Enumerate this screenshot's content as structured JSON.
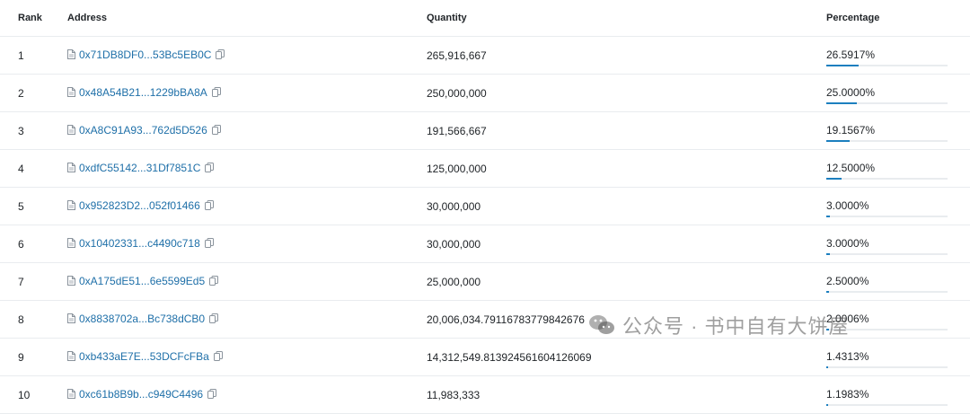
{
  "headers": {
    "rank": "Rank",
    "address": "Address",
    "quantity": "Quantity",
    "percentage": "Percentage"
  },
  "rows": [
    {
      "rank": "1",
      "address": "0x71DB8DF0...53Bc5EB0C",
      "quantity": "265,916,667",
      "percentage": "26.5917%",
      "fraction": 0.265917
    },
    {
      "rank": "2",
      "address": "0x48A54B21...1229bBA8A",
      "quantity": "250,000,000",
      "percentage": "25.0000%",
      "fraction": 0.25
    },
    {
      "rank": "3",
      "address": "0xA8C91A93...762d5D526",
      "quantity": "191,566,667",
      "percentage": "19.1567%",
      "fraction": 0.191567
    },
    {
      "rank": "4",
      "address": "0xdfC55142...31Df7851C",
      "quantity": "125,000,000",
      "percentage": "12.5000%",
      "fraction": 0.125
    },
    {
      "rank": "5",
      "address": "0x952823D2...052f01466",
      "quantity": "30,000,000",
      "percentage": "3.0000%",
      "fraction": 0.03
    },
    {
      "rank": "6",
      "address": "0x10402331...c4490c718",
      "quantity": "30,000,000",
      "percentage": "3.0000%",
      "fraction": 0.03
    },
    {
      "rank": "7",
      "address": "0xA175dE51...6e5599Ed5",
      "quantity": "25,000,000",
      "percentage": "2.5000%",
      "fraction": 0.025
    },
    {
      "rank": "8",
      "address": "0x8838702a...Bc738dCB0",
      "quantity": "20,006,034.79116783779842676",
      "percentage": "2.0006%",
      "fraction": 0.020006
    },
    {
      "rank": "9",
      "address": "0xb433aE7E...53DCFcFBa",
      "quantity": "14,312,549.813924561604126069",
      "percentage": "1.4313%",
      "fraction": 0.014313
    },
    {
      "rank": "10",
      "address": "0xc61b8B9b...c949C4496",
      "quantity": "11,983,333",
      "percentage": "1.1983%",
      "fraction": 0.011983
    }
  ],
  "watermark": {
    "text": "公众号 · 书中自有大饼屋"
  },
  "icons": {
    "address": "document-icon",
    "copy": "copy-icon",
    "watermark": "wechat-icon"
  },
  "colors": {
    "link": "#1e6fa8",
    "bar": "#1c7fbf",
    "bar_track": "#e9ecef",
    "border": "#e9ecef"
  }
}
